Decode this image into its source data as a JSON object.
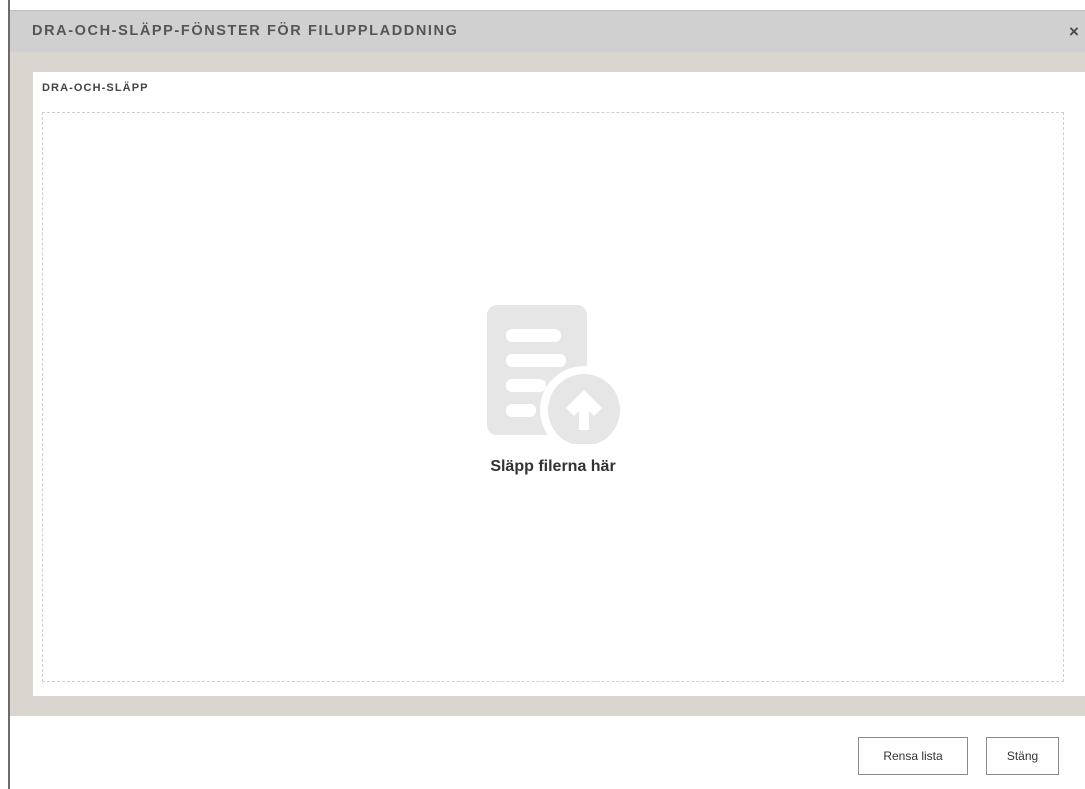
{
  "dialog": {
    "title": "DRA-OCH-SLÄPP-FÖNSTER FÖR FILUPPLADDNING",
    "close_glyph": "×"
  },
  "panel": {
    "label": "DRA-OCH-SLÄPP"
  },
  "dropzone": {
    "icon": "file-upload-icon",
    "text": "Släpp filerna här"
  },
  "footer": {
    "clear_label": "Rensa lista",
    "close_label": "Stäng"
  },
  "colors": {
    "titlebar": "#d0d0d0",
    "body_background": "#d9d6d0",
    "icon_gray": "#e6e6e6"
  }
}
